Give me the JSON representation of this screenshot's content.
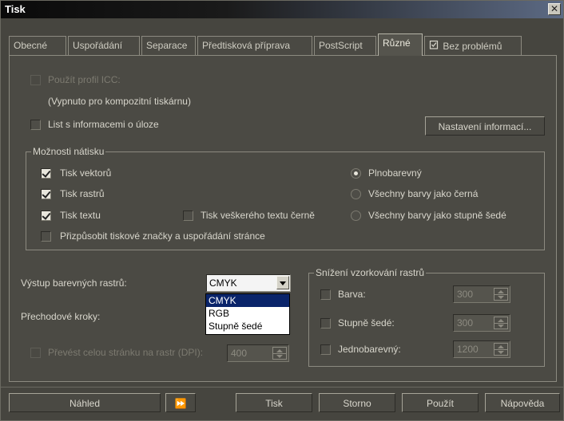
{
  "window": {
    "title": "Tisk",
    "close_label": "✕"
  },
  "tabs": [
    {
      "label": "Obecné"
    },
    {
      "label": "Uspořádání"
    },
    {
      "label": "Separace"
    },
    {
      "label": "Předtisková příprava"
    },
    {
      "label": "PostScript"
    },
    {
      "label": "Různé"
    },
    {
      "label": "Bez problémů",
      "icon": "clipboard-check-icon"
    }
  ],
  "active_tab": "Různé",
  "icc": {
    "use_profile_label": "Použít profil ICC:",
    "use_profile_checked": false,
    "note": "(Vypnuto pro kompozitní tiskárnu)"
  },
  "job_info": {
    "label": "List s informacemi o úloze",
    "checked": false,
    "button_label": "Nastavení informací..."
  },
  "print_options": {
    "title": "Možnosti nátisku",
    "print_vectors": {
      "label": "Tisk vektorů",
      "checked": true
    },
    "print_rasters": {
      "label": "Tisk rastrů",
      "checked": true
    },
    "print_text": {
      "label": "Tisk textu",
      "checked": true
    },
    "print_all_text_black": {
      "label": "Tisk veškerého textu černě",
      "checked": false
    },
    "fit_marks": {
      "label": "Přizpůsobit tiskové značky a uspořádání stránce",
      "checked": false
    },
    "color_modes": [
      {
        "label": "Plnobarevný",
        "selected": true
      },
      {
        "label": "Všechny barvy jako černá",
        "selected": false
      },
      {
        "label": "Všechny barvy jako stupně šedé",
        "selected": false
      }
    ]
  },
  "raster_output": {
    "label": "Výstup barevných rastrů:",
    "selected": "CMYK",
    "options": [
      "CMYK",
      "RGB",
      "Stupně šedé"
    ]
  },
  "gradient_steps": {
    "label": "Přechodové kroky:"
  },
  "rasterize_page": {
    "label": "Převést celou stránku na rastr (DPI):",
    "checked": false,
    "value": "400"
  },
  "downsampling": {
    "title": "Snížení vzorkování rastrů",
    "color": {
      "label": "Barva:",
      "checked": false,
      "value": "300"
    },
    "grayscale": {
      "label": "Stupně šedé:",
      "checked": false,
      "value": "300"
    },
    "monochrome": {
      "label": "Jednobarevný:",
      "checked": false,
      "value": "1200"
    }
  },
  "buttons": {
    "preview": "Náhled",
    "more": "⏩",
    "print": "Tisk",
    "cancel": "Storno",
    "apply": "Použít",
    "help": "Nápověda"
  },
  "colors": {
    "background": "#46453f",
    "selection": "#0a246a",
    "titlebar": "#0a0a0a"
  }
}
